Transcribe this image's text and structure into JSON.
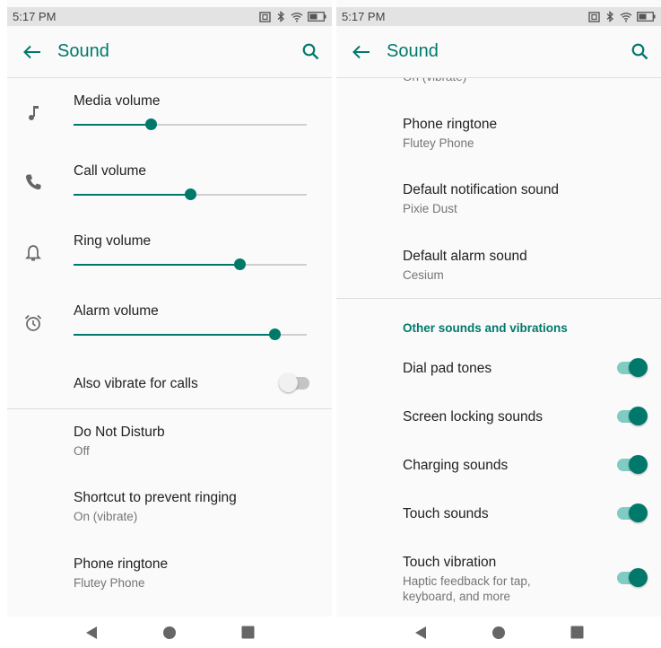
{
  "colors": {
    "accent": "#00796b",
    "accent_light": "#80cbc4",
    "text_primary": "#202124",
    "text_secondary": "#757575"
  },
  "left": {
    "status": {
      "time": "5:17 PM"
    },
    "title": "Sound",
    "sliders": [
      {
        "label": "Media volume",
        "icon": "music-note-icon",
        "value": 0.33
      },
      {
        "label": "Call volume",
        "icon": "phone-icon",
        "value": 0.5
      },
      {
        "label": "Ring volume",
        "icon": "bell-icon",
        "value": 0.71
      },
      {
        "label": "Alarm volume",
        "icon": "alarm-clock-icon",
        "value": 0.86
      }
    ],
    "vibrate": {
      "label": "Also vibrate for calls",
      "on": false
    },
    "items": [
      {
        "title": "Do Not Disturb",
        "summary": "Off"
      },
      {
        "title": "Shortcut to prevent ringing",
        "summary": "On (vibrate)"
      },
      {
        "title": "Phone ringtone",
        "summary": "Flutey Phone"
      }
    ]
  },
  "right": {
    "status": {
      "time": "5:17 PM"
    },
    "title": "Sound",
    "partial_summary": "On (vibrate)",
    "items": [
      {
        "title": "Phone ringtone",
        "summary": "Flutey Phone"
      },
      {
        "title": "Default notification sound",
        "summary": "Pixie Dust"
      },
      {
        "title": "Default alarm sound",
        "summary": "Cesium"
      }
    ],
    "section_header": "Other sounds and vibrations",
    "toggles": [
      {
        "label": "Dial pad tones",
        "on": true
      },
      {
        "label": "Screen locking sounds",
        "on": true
      },
      {
        "label": "Charging sounds",
        "on": true
      },
      {
        "label": "Touch sounds",
        "on": true
      },
      {
        "label": "Touch vibration",
        "summary_line1": "Haptic feedback for tap,",
        "summary_line2": "keyboard, and more",
        "on": true
      }
    ]
  }
}
